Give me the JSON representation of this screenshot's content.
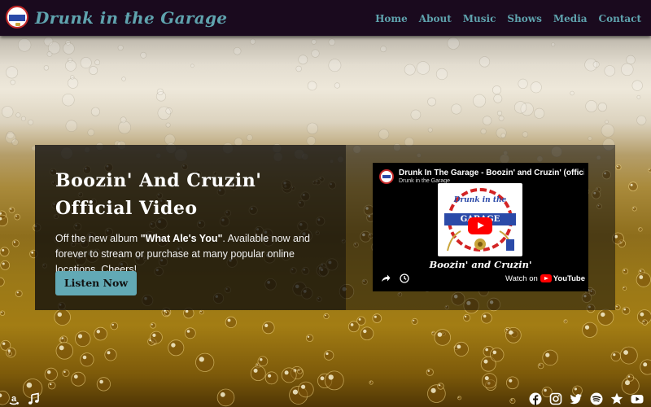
{
  "header": {
    "brand": "Drunk in the Garage",
    "nav": [
      "Home",
      "About",
      "Music",
      "Shows",
      "Media",
      "Contact"
    ]
  },
  "feature": {
    "title_line1": "Boozin' And Cruzin'",
    "title_line2": "Official Video",
    "text_before": "Off the new album ",
    "album": "\"What Ale's You\"",
    "text_after": ". Available now and forever to stream or purchase at many popular online locations. Cheers!",
    "button": "Listen Now"
  },
  "video": {
    "title": "Drunk In The Garage - Boozin' and Cruzin' (official)",
    "channel": "Drunk in the Garage",
    "thumb_line1": "Drunk",
    "thumb_line2": "in the",
    "thumb_line3": "GARAGE",
    "caption": "Boozin' and Cruzin'",
    "watch_on": "Watch on",
    "youtube": "YouTube"
  },
  "footer_icons": {
    "left": [
      "amazon-icon",
      "music-note-icon"
    ],
    "right": [
      "facebook-icon",
      "instagram-icon",
      "twitter-icon",
      "spotify-icon",
      "star-icon",
      "youtube-icon"
    ]
  },
  "colors": {
    "header_bg": "#1a0a1e",
    "accent_teal": "#5fa3ae",
    "button_bg": "#62a9b5",
    "youtube_red": "#ff0000"
  }
}
